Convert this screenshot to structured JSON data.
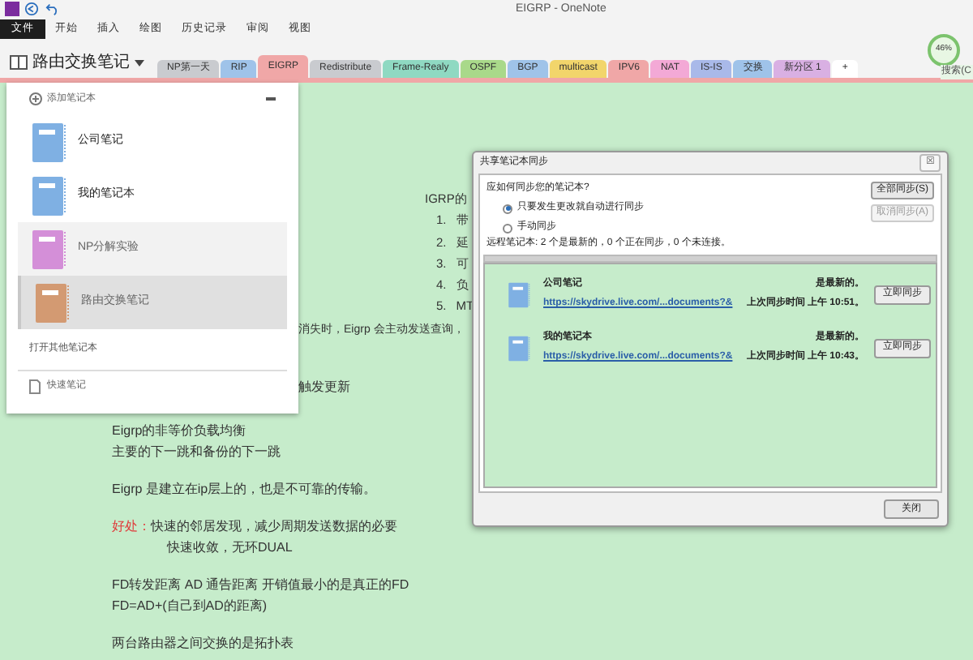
{
  "window": {
    "title": "EIGRP - OneNote"
  },
  "ribbon_tabs": [
    {
      "label": "文件",
      "selected": true
    },
    {
      "label": "开始",
      "selected": false
    },
    {
      "label": "插入",
      "selected": false
    },
    {
      "label": "绘图",
      "selected": false
    },
    {
      "label": "历史记录",
      "selected": false
    },
    {
      "label": "审阅",
      "selected": false
    },
    {
      "label": "视图",
      "selected": false
    }
  ],
  "notebook_title": "路由交换笔记",
  "sections": [
    {
      "label": "NP第一天",
      "color": "#c9cbcf",
      "selected": false
    },
    {
      "label": "RIP",
      "color": "#9fc3e9",
      "selected": false
    },
    {
      "label": "EIGRP",
      "color": "#f0a7a7",
      "selected": true
    },
    {
      "label": "Redistribute",
      "color": "#c9cbcf",
      "selected": false
    },
    {
      "label": "Frame-Realy",
      "color": "#8fd9c2",
      "selected": false
    },
    {
      "label": "OSPF",
      "color": "#a9d98a",
      "selected": false
    },
    {
      "label": "BGP",
      "color": "#9fc3e9",
      "selected": false
    },
    {
      "label": "multicast",
      "color": "#f2d56b",
      "selected": false
    },
    {
      "label": "IPV6",
      "color": "#f0a7a7",
      "selected": false
    },
    {
      "label": "NAT",
      "color": "#f3a9d6",
      "selected": false
    },
    {
      "label": "IS-IS",
      "color": "#a9b9e9",
      "selected": false
    },
    {
      "label": "交换",
      "color": "#9fc3e9",
      "selected": false
    },
    {
      "label": "新分区 1",
      "color": "#d9b0e3",
      "selected": false
    },
    {
      "label": "+",
      "color": "#ffffff",
      "selected": false
    }
  ],
  "search_label": "搜索(C",
  "zoom_badge": "46%",
  "notebook_menu": {
    "add_label": "添加笔记本",
    "notebooks": [
      {
        "name": "公司笔记",
        "color": "#7fb0e3",
        "selected": false,
        "highlighted": false
      },
      {
        "name": "我的笔记本",
        "color": "#7fb0e3",
        "selected": false,
        "highlighted": false
      },
      {
        "name": "NP分解实验",
        "color": "#d48fd8",
        "selected": false,
        "highlighted": true
      },
      {
        "name": "路由交换笔记",
        "color": "#d39a72",
        "selected": true,
        "highlighted": true
      }
    ],
    "open_other": "打开其他笔记本",
    "quick_notes": "快速笔记"
  },
  "page": {
    "igrp_heading": "IGRP的",
    "igrp_items": [
      {
        "number": "1.",
        "text": "带"
      },
      {
        "number": "2.",
        "text": "延"
      },
      {
        "number": "3.",
        "text": "可"
      },
      {
        "number": "4.",
        "text": "负"
      },
      {
        "number": "5.",
        "text": "MT"
      }
    ],
    "lines_partial": [
      "消失时，Eigrp 会主动发送查询，",
      "触发更新"
    ],
    "lines": [
      {
        "kind": "plain",
        "text": "Eigrp的非等价负载均衡"
      },
      {
        "kind": "plain",
        "text": "主要的下一跳和备份的下一跳"
      },
      {
        "kind": "gap"
      },
      {
        "kind": "plain",
        "text": "Eigrp 是建立在ip层上的，也是不可靠的传输。"
      },
      {
        "kind": "gap"
      },
      {
        "kind": "labeled",
        "label": "好处：",
        "text": "快速的邻居发现，减少周期发送数据的必要"
      },
      {
        "kind": "indent",
        "text": "快速收敛，无环DUAL"
      },
      {
        "kind": "gap"
      },
      {
        "kind": "plain",
        "text": "FD转发距离 AD 通告距离  开销值最小的是真正的FD"
      },
      {
        "kind": "plain",
        "text": "FD=AD+(自己到AD的距离)"
      },
      {
        "kind": "gap"
      },
      {
        "kind": "plain",
        "text": "两台路由器之间交换的是拓扑表"
      }
    ]
  },
  "sync_dialog": {
    "title": "共享笔记本同步",
    "close_glyph": "☒",
    "question": "应如何同步您的笔记本?",
    "options": [
      {
        "label": "只要发生更改就自动进行同步",
        "selected": true
      },
      {
        "label": "手动同步",
        "selected": false
      }
    ],
    "sync_all": {
      "label": "全部同步(S)",
      "disabled": false
    },
    "cancel_sync": {
      "label": "取消同步(A)",
      "disabled": true
    },
    "summary": "远程笔记本: 2 个是最新的，0 个正在同步，0 个未连接。",
    "progress": {
      "level": 1
    },
    "notebooks": [
      {
        "name": "公司笔记",
        "url": "https://skydrive.live.com/...documents?&",
        "status": "是最新的。",
        "last_sync": "上次同步时间 上午 10:51。",
        "button": "立即同步"
      },
      {
        "name": "我的笔记本",
        "url": "https://skydrive.live.com/...documents?&",
        "status": "是最新的。",
        "last_sync": "上次同步时间 上午 10:43。",
        "button": "立即同步"
      }
    ],
    "close_button": "关闭"
  }
}
